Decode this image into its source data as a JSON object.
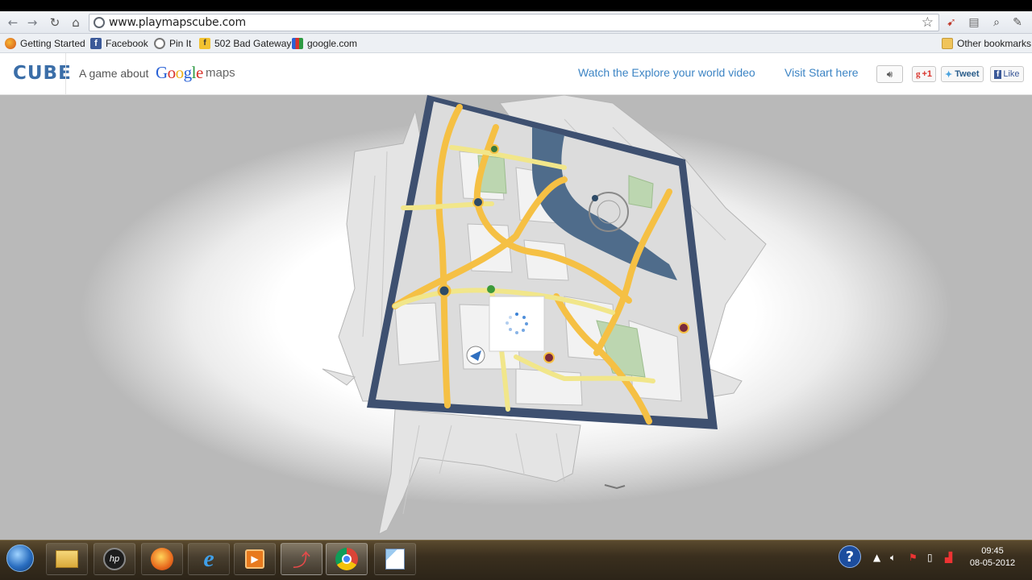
{
  "browser": {
    "url": "www.playmapscube.com",
    "bookmarks": [
      {
        "label": "Getting Started",
        "icon": "firefox-icon"
      },
      {
        "label": "Facebook",
        "icon": "facebook-icon"
      },
      {
        "label": "Pin It",
        "icon": "pinterest-icon"
      },
      {
        "label": "502 Bad Gateway",
        "icon": "gateway-icon"
      },
      {
        "label": "google.com",
        "icon": "google-favicon-icon"
      }
    ],
    "other_bookmarks": "Other bookmarks"
  },
  "site": {
    "logo": "CUBE",
    "tagline": "A game about",
    "google": [
      "G",
      "o",
      "o",
      "g",
      "l",
      "e"
    ],
    "google_colors": [
      "#2a62d6",
      "#d9332b",
      "#f0b21b",
      "#2a62d6",
      "#2d9a42",
      "#d9332b"
    ],
    "maps": "maps",
    "link_video": "Watch the Explore your world video",
    "link_start": "Visit Start here",
    "gplus": "+1",
    "tweet": "Tweet",
    "like": "Like"
  },
  "taskbar": {
    "apps": [
      "windows-explorer-icon",
      "hp-icon",
      "firefox-icon",
      "internet-explorer-icon",
      "media-player-icon",
      "drawing-app-icon",
      "chrome-icon",
      "paint-icon"
    ],
    "time": "09:45",
    "date": "08-05-2012"
  }
}
